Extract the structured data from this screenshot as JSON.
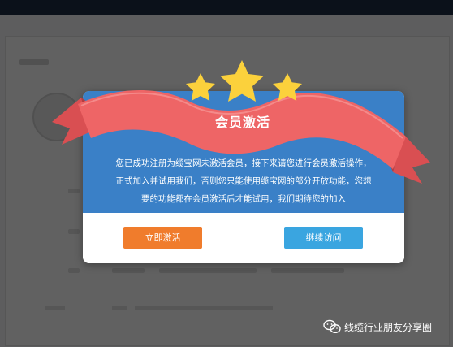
{
  "modal": {
    "title": "会员激活",
    "message_lines": [
      "您已成功注册为缆宝网未激活会员，接下来请您进行会员激活操作，",
      "正式加入并试用我们，否则您只能使用缆宝网的部分开放功能，您想",
      "要的功能都在会员激活后才能试用，我们期待您的加入"
    ],
    "activate_label": "立即激活",
    "continue_label": "继续访问"
  },
  "watermark": {
    "text": "线缆行业朋友分享圈",
    "icon": "wechat-icon"
  },
  "colors": {
    "modal_body": "#3a80c7",
    "ribbon": "#ee6566",
    "star": "#fbd13c",
    "activate_button": "#f07c2c",
    "continue_button": "#3aa5e0"
  }
}
